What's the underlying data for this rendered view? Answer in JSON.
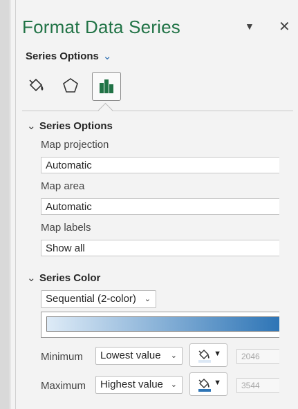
{
  "panel": {
    "title": "Format Data Series",
    "pin_icon": "dropdown-triangle-icon",
    "close_icon": "close-icon",
    "options_dropdown": "Series Options",
    "tabs": [
      {
        "name": "fill-line",
        "icon": "paint-bucket-icon"
      },
      {
        "name": "effects",
        "icon": "pentagon-icon"
      },
      {
        "name": "series-options",
        "icon": "bar-chart-icon",
        "active": true
      }
    ]
  },
  "series_options": {
    "heading": "Series Options",
    "map_projection_label": "Map projection",
    "map_projection_value": "Automatic",
    "map_area_label": "Map area",
    "map_area_value": "Automatic",
    "map_labels_label": "Map labels",
    "map_labels_value": "Show all"
  },
  "series_color": {
    "heading": "Series Color",
    "scheme": "Sequential (2-color)",
    "gradient": {
      "start": "#deebf7",
      "end": "#2e75b6"
    },
    "minimum_label": "Minimum",
    "minimum_type": "Lowest value",
    "minimum_number": "2046",
    "maximum_label": "Maximum",
    "maximum_type": "Highest value",
    "maximum_number": "3544",
    "min_color": "#dce8f5",
    "max_color": "#2e75b6"
  },
  "colors": {
    "accent_green": "#217346",
    "accent_blue": "#2b6cb0"
  }
}
